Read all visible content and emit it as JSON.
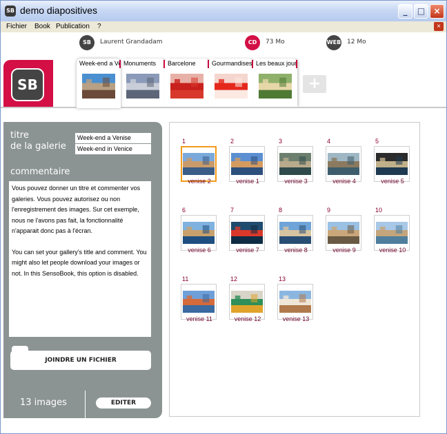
{
  "window": {
    "title": "demo diapositives",
    "app_icon": "SB",
    "buttons": [
      "_",
      "□",
      "×"
    ]
  },
  "menu": {
    "items": [
      "Fichier",
      "Book",
      "Publication",
      "?"
    ],
    "close_glyph": "×"
  },
  "stats": [
    {
      "badge": "SB",
      "label": "Laurent Grandadam",
      "color": "#444444"
    },
    {
      "badge": "CD",
      "label": "73 Mo",
      "color": "#d30f45"
    },
    {
      "badge": "WEB",
      "label": "12 Mo",
      "color": "#444444"
    }
  ],
  "logo": {
    "text": "SB",
    "color": "#d30f45"
  },
  "albums": [
    {
      "name": "Week-end a Venise",
      "thumb": [
        "#4a8fd0",
        "#b7a084",
        "#6b4a3a"
      ]
    },
    {
      "name": "Monuments",
      "thumb": [
        "#8a9ab8",
        "#c9ced8",
        "#5c6678"
      ]
    },
    {
      "name": "Barcelone",
      "thumb": [
        "#e8b1a8",
        "#c8201c",
        "#d8382c"
      ]
    },
    {
      "name": "Gourmandises",
      "thumb": [
        "#f4d6cf",
        "#e4281c",
        "#fbe9e2"
      ]
    },
    {
      "name": "Les beaux jours",
      "thumb": [
        "#8fb06a",
        "#e6d7a9",
        "#4f7a34"
      ]
    }
  ],
  "add_album_label": "+",
  "side": {
    "title_label_line1": "titre",
    "title_label_line2": "de la galerie",
    "title_fr": "Week-end a Venise",
    "title_en": "Week-end in Venice",
    "comment_label": "commentaire",
    "comment_fr": "Vous pouvez donner un titre et commenter vos galeries. Vous pouvez autorisez ou non l'enregistrement des images. Sur cet exemple, nous ne l'avons pas fait, la fonctionnalité n'apparait donc pas à l'écran.",
    "comment_en": "You can set your gallery's title and comment. You might also let people download your images or not. In this SensoBook, this option is disabled.",
    "attach_label": "JOINDRE UN FICHIER",
    "count_label": "13 images",
    "edit_label": "EDITER"
  },
  "gallery": {
    "selected": 1,
    "items": [
      {
        "num": "1",
        "label": "venise 2",
        "colors": [
          "#7aa9dc",
          "#c99b6a",
          "#3a5c86"
        ]
      },
      {
        "num": "2",
        "label": "venise 1",
        "colors": [
          "#5b8fd1",
          "#d49b5f",
          "#2d4f7c"
        ]
      },
      {
        "num": "3",
        "label": "venise 3",
        "colors": [
          "#6c7f6e",
          "#b8aa8c",
          "#2f4a4a"
        ]
      },
      {
        "num": "4",
        "label": "venise 4",
        "colors": [
          "#9fb7c4",
          "#8b7a5f",
          "#3d5d6c"
        ]
      },
      {
        "num": "5",
        "label": "venise 5",
        "colors": [
          "#2b2b2b",
          "#c0b08a",
          "#1d3a52"
        ]
      },
      {
        "num": "6",
        "label": "venise 6",
        "colors": [
          "#7fb2de",
          "#c8a06c",
          "#1e4f80"
        ]
      },
      {
        "num": "7",
        "label": "venise 7",
        "colors": [
          "#1f4b6e",
          "#d9382a",
          "#0f2c44"
        ]
      },
      {
        "num": "8",
        "label": "venise 8",
        "colors": [
          "#6fa4d8",
          "#d7c4a0",
          "#294e74"
        ]
      },
      {
        "num": "9",
        "label": "venise 9",
        "colors": [
          "#9ac0e4",
          "#c9a77a",
          "#6a5a44"
        ]
      },
      {
        "num": "10",
        "label": "venise 10",
        "colors": [
          "#a9c7e6",
          "#c4a57c",
          "#4f7f9c"
        ]
      },
      {
        "num": "11",
        "label": "venise 11",
        "colors": [
          "#6f9fd8",
          "#d56a3a",
          "#3a6aa0"
        ]
      },
      {
        "num": "12",
        "label": "venise 12",
        "colors": [
          "#d9d4c8",
          "#2f8f5a",
          "#e0a42c"
        ]
      },
      {
        "num": "13",
        "label": "venise 13",
        "colors": [
          "#8bb6e0",
          "#efe6d8",
          "#b07a4e"
        ]
      }
    ]
  }
}
